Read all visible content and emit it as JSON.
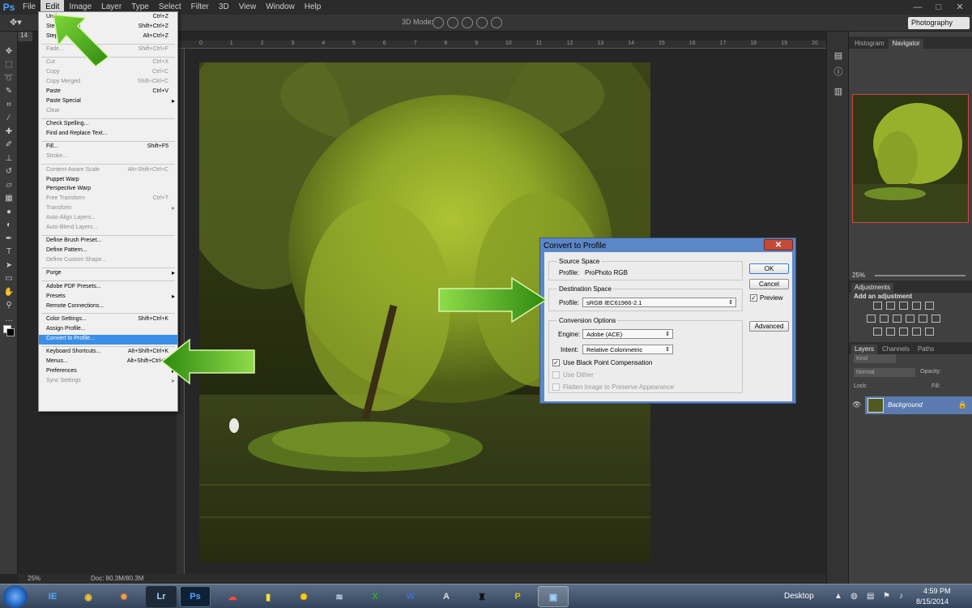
{
  "app": {
    "logo": "Ps",
    "menus": [
      "File",
      "Edit",
      "Image",
      "Layer",
      "Type",
      "Select",
      "Filter",
      "3D",
      "View",
      "Window",
      "Help"
    ],
    "active_menu": "Edit",
    "window_controls": [
      "—",
      "□",
      "✕"
    ]
  },
  "options_bar": {
    "tool_icon": "move-tool",
    "mode_3d_label": "3D Mode:",
    "workspace": "Photography"
  },
  "rulers": {
    "horizontal_ticks": [
      "0",
      "1",
      "2",
      "3",
      "4",
      "5",
      "6",
      "7",
      "8",
      "9",
      "10",
      "11",
      "12",
      "13",
      "14",
      "15",
      "16",
      "17",
      "18",
      "19",
      "20"
    ]
  },
  "document": {
    "tab_label": "14",
    "zoom": "25%",
    "doc_size": "Doc: 80.3M/80.3M"
  },
  "edit_menu": {
    "items": [
      {
        "label": "Undo",
        "shortcut": "Ctrl+Z",
        "disabled": false
      },
      {
        "label": "Step Forward",
        "shortcut": "Shift+Ctrl+Z",
        "disabled": false
      },
      {
        "label": "Step Backward",
        "shortcut": "Alt+Ctrl+Z",
        "disabled": false
      },
      {
        "sep": true
      },
      {
        "label": "Fade...",
        "shortcut": "Shift+Ctrl+F",
        "disabled": true
      },
      {
        "sep": true
      },
      {
        "label": "Cut",
        "shortcut": "Ctrl+X",
        "disabled": true
      },
      {
        "label": "Copy",
        "shortcut": "Ctrl+C",
        "disabled": true
      },
      {
        "label": "Copy Merged",
        "shortcut": "Shift+Ctrl+C",
        "disabled": true
      },
      {
        "label": "Paste",
        "shortcut": "Ctrl+V",
        "disabled": false
      },
      {
        "label": "Paste Special",
        "shortcut": "",
        "disabled": false,
        "submenu": true
      },
      {
        "label": "Clear",
        "shortcut": "",
        "disabled": true
      },
      {
        "sep": true
      },
      {
        "label": "Check Spelling...",
        "shortcut": "",
        "disabled": false
      },
      {
        "label": "Find and Replace Text...",
        "shortcut": "",
        "disabled": false
      },
      {
        "sep": true
      },
      {
        "label": "Fill...",
        "shortcut": "Shift+F5",
        "disabled": false
      },
      {
        "label": "Stroke...",
        "shortcut": "",
        "disabled": true
      },
      {
        "sep": true
      },
      {
        "label": "Content-Aware Scale",
        "shortcut": "Alt+Shift+Ctrl+C",
        "disabled": true
      },
      {
        "label": "Puppet Warp",
        "shortcut": "",
        "disabled": false
      },
      {
        "label": "Perspective Warp",
        "shortcut": "",
        "disabled": false
      },
      {
        "label": "Free Transform",
        "shortcut": "Ctrl+T",
        "disabled": true
      },
      {
        "label": "Transform",
        "shortcut": "",
        "disabled": true,
        "submenu": true
      },
      {
        "label": "Auto-Align Layers...",
        "shortcut": "",
        "disabled": true
      },
      {
        "label": "Auto-Blend Layers...",
        "shortcut": "",
        "disabled": true
      },
      {
        "sep": true
      },
      {
        "label": "Define Brush Preset...",
        "shortcut": "",
        "disabled": false
      },
      {
        "label": "Define Pattern...",
        "shortcut": "",
        "disabled": false
      },
      {
        "label": "Define Custom Shape...",
        "shortcut": "",
        "disabled": true
      },
      {
        "sep": true
      },
      {
        "label": "Purge",
        "shortcut": "",
        "disabled": false,
        "submenu": true
      },
      {
        "sep": true
      },
      {
        "label": "Adobe PDF Presets...",
        "shortcut": "",
        "disabled": false
      },
      {
        "label": "Presets",
        "shortcut": "",
        "disabled": false,
        "submenu": true
      },
      {
        "label": "Remote Connections...",
        "shortcut": "",
        "disabled": false
      },
      {
        "sep": true
      },
      {
        "label": "Color Settings...",
        "shortcut": "Shift+Ctrl+K",
        "disabled": false
      },
      {
        "label": "Assign Profile...",
        "shortcut": "",
        "disabled": false
      },
      {
        "label": "Convert to Profile...",
        "shortcut": "",
        "disabled": false,
        "highlighted": true
      },
      {
        "sep": true
      },
      {
        "label": "Keyboard Shortcuts...",
        "shortcut": "Alt+Shift+Ctrl+K",
        "disabled": false
      },
      {
        "label": "Menus...",
        "shortcut": "Alt+Shift+Ctrl+M",
        "disabled": false
      },
      {
        "label": "Preferences",
        "shortcut": "",
        "disabled": false,
        "submenu": true
      },
      {
        "label": "Sync Settings",
        "shortcut": "",
        "disabled": true,
        "submenu": true
      }
    ]
  },
  "dialog": {
    "title": "Convert to Profile",
    "close": "✕",
    "source_space_title": "Source Space",
    "source_profile_label": "Profile:",
    "source_profile_value": "ProPhoto RGB",
    "destination_space_title": "Destination Space",
    "dest_profile_label": "Profile:",
    "dest_profile_value": "sRGB IEC61966-2.1",
    "conversion_options_title": "Conversion Options",
    "engine_label": "Engine:",
    "engine_value": "Adobe (ACE)",
    "intent_label": "Intent:",
    "intent_value": "Relative Colorimetric",
    "black_point_label": "Use Black Point Compensation",
    "black_point_checked": true,
    "use_dither_label": "Use Dither",
    "flatten_label": "Flatten Image to Preserve Appearance",
    "ok": "OK",
    "cancel": "Cancel",
    "preview_label": "Preview",
    "preview_checked": true,
    "advanced": "Advanced"
  },
  "right_panels": {
    "top_tabs": [
      "Histogram",
      "Navigator"
    ],
    "nav_zoom": "25%",
    "adjustments_tab": "Adjustments",
    "add_adjustment": "Add an adjustment",
    "layer_tabs": [
      "Layers",
      "Channels",
      "Paths"
    ],
    "kind_label": "Kind",
    "blend_mode": "Normal",
    "opacity_label": "Opacity:",
    "lock_label": "Lock:",
    "fill_label": "Fill:",
    "layer_name": "Background"
  },
  "taskbar": {
    "apps": [
      "IE",
      "Chrome",
      "App",
      "Lr",
      "Ps",
      "Creative Cloud",
      "App",
      "App",
      "Excel",
      "Word",
      "Translate",
      "App",
      "App",
      "Control Panel"
    ],
    "desktop_label": "Desktop",
    "time": "4:59 PM",
    "date": "8/15/2014"
  },
  "colors": {
    "menu_highlight": "#3d8ee6",
    "arrow_green": "#5cb81e",
    "dialog_titlebar": "#5c87c6",
    "close_button": "#c24a38"
  }
}
